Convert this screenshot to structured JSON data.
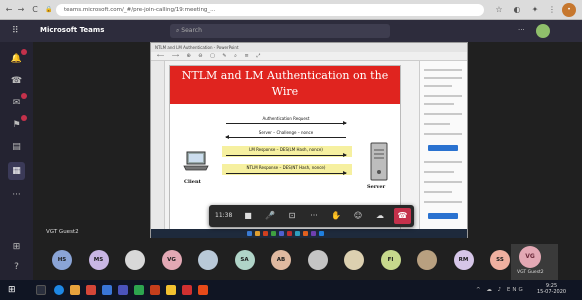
{
  "browser": {
    "url": "teams.microsoft.com/_#/pre-join-calling/19:meeting_...",
    "nav_back": "←",
    "nav_forward": "→",
    "nav_reload": "C",
    "lock": "🔒",
    "star": "☆",
    "menu": "⋮",
    "profile_initial": "•"
  },
  "teams": {
    "app_title": "Microsoft Teams",
    "search_placeholder": "Search",
    "more": "···"
  },
  "rail": [
    "activity",
    "chat",
    "teams",
    "calendar",
    "calls",
    "files",
    "apps",
    "help"
  ],
  "shared": {
    "window_title": "NTLM and LM Authentication - PowerPoint",
    "toolbar": "⟵ ⟶ ⊕ ⊖ ▢ ✎ ⌕ ≡ ⤢",
    "slide": {
      "title": "NTLM and LM Authentication on the Wire",
      "msg1": "Authentication Request",
      "msg2": "Server – Challenge – nonce",
      "msg3": "LM Response – DES(LM Hash, nonce)",
      "msg4": "NTLM Response – DES(NT Hash, nonce)",
      "msg5": "Authentication Result",
      "client_label": "Client",
      "server_label": "Server"
    }
  },
  "controls": {
    "timer": "11:38",
    "camera_icon": "■",
    "mic_icon": "🎤",
    "share_icon": "⊡",
    "more_icon": "···",
    "hand_icon": "✋",
    "react_icon": "☺",
    "people_icon": "☁",
    "hangup_icon": "☎"
  },
  "tile_label": "VGT Guest2",
  "participants": [
    {
      "initials": "HS",
      "color": "#8aa4d6"
    },
    {
      "initials": "MS",
      "color": "#c9b6e4"
    },
    {
      "initials": "",
      "color": "#d8d8d8"
    },
    {
      "initials": "VG",
      "color": "#e3a8b4"
    },
    {
      "initials": "",
      "color": "#b9c9d8"
    },
    {
      "initials": "SA",
      "color": "#b0d4c8"
    },
    {
      "initials": "AB",
      "color": "#e0b9a0"
    },
    {
      "initials": "",
      "color": "#c4c4c4"
    },
    {
      "initials": "",
      "color": "#dcd0b0"
    },
    {
      "initials": "FI",
      "color": "#c7d98c"
    },
    {
      "initials": "",
      "color": "#b8a080"
    },
    {
      "initials": "RM",
      "color": "#d6c6e8"
    },
    {
      "initials": "SS",
      "color": "#f0b0a0"
    }
  ],
  "self": {
    "initials": "VG",
    "name": "VGT Guest2"
  },
  "taskbar": {
    "start": "⊞",
    "clock_time": "9:25",
    "clock_date": "15-07-2020",
    "tray": "^ ☁ ♪ ENG"
  }
}
